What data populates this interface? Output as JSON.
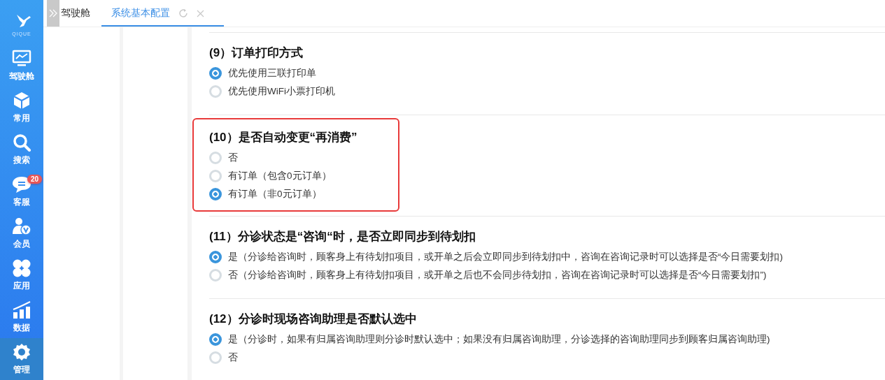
{
  "sidebar": {
    "logo_text": "QIQUE",
    "items": [
      {
        "label": "驾驶舱",
        "selected": false
      },
      {
        "label": "常用",
        "selected": false
      },
      {
        "label": "搜索",
        "selected": false
      },
      {
        "label": "客服",
        "selected": false,
        "badge": "20"
      },
      {
        "label": "会员",
        "selected": false
      },
      {
        "label": "应用",
        "selected": false
      },
      {
        "label": "数据",
        "selected": false
      },
      {
        "label": "管理",
        "selected": true
      }
    ]
  },
  "tabs": [
    {
      "label": "驾驶舱",
      "selected": false
    },
    {
      "label": "系统基本配置",
      "selected": true
    }
  ],
  "sections": [
    {
      "title": "(9）订单打印方式",
      "highlighted": false,
      "options": [
        {
          "label": "优先使用三联打印单",
          "selected": true
        },
        {
          "label": "优先使用WiFi小票打印机",
          "selected": false
        }
      ]
    },
    {
      "title": "(10）是否自动变更“再消费”",
      "highlighted": true,
      "options": [
        {
          "label": "否",
          "selected": false
        },
        {
          "label": "有订单（包含0元订单）",
          "selected": false
        },
        {
          "label": "有订单（非0元订单）",
          "selected": true
        }
      ]
    },
    {
      "title": "(11）分诊状态是“咨询“时，是否立即同步到待划扣",
      "highlighted": false,
      "options": [
        {
          "label": "是（分诊给咨询时，顾客身上有待划扣项目，或开单之后会立即同步到待划扣中，咨询在咨询记录时可以选择是否“今日需要划扣)",
          "selected": true
        },
        {
          "label": "否（分诊给咨询时，顾客身上有待划扣项目，或开单之后也不会同步待划扣，咨询在咨询记录时可以选择是否“今日需要划扣”)",
          "selected": false
        }
      ]
    },
    {
      "title": "(12）分诊时现场咨询助理是否默认选中",
      "highlighted": false,
      "options": [
        {
          "label": "是（分诊时，如果有归属咨询助理则分诊时默认选中；如果没有归属咨询助理，分诊选择的咨询助理同步到顾客归属咨询助理)",
          "selected": true
        },
        {
          "label": "否",
          "selected": false
        }
      ]
    }
  ]
}
